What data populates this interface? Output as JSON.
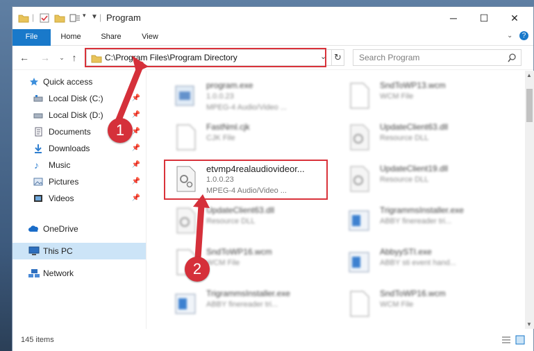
{
  "window": {
    "title": "Program"
  },
  "ribbon": {
    "tabs": [
      "File",
      "Home",
      "Share",
      "View"
    ]
  },
  "address": {
    "path": "C:\\Program Files\\Program Directory"
  },
  "search": {
    "placeholder": "Search Program"
  },
  "sidebar": {
    "items": [
      {
        "label": "Quick access",
        "icon": "star-icon"
      },
      {
        "label": "Local Disk (C:)",
        "icon": "drive-icon"
      },
      {
        "label": "Local Disk (D:)",
        "icon": "drive-icon"
      },
      {
        "label": "Documents",
        "icon": "documents-icon"
      },
      {
        "label": "Downloads",
        "icon": "download-icon"
      },
      {
        "label": "Music",
        "icon": "music-icon"
      },
      {
        "label": "Pictures",
        "icon": "pictures-icon"
      },
      {
        "label": "Videos",
        "icon": "videos-icon"
      },
      {
        "label": "OneDrive",
        "icon": "cloud-icon"
      },
      {
        "label": "This PC",
        "icon": "computer-icon"
      },
      {
        "label": "Network",
        "icon": "network-icon"
      }
    ]
  },
  "files": [
    {
      "name": "program.exe",
      "version": "1.0.0.23",
      "type": "MPEG-4 Audio/Video ..."
    },
    {
      "name": "SndToWP13.wcm",
      "version": "",
      "type": "WCM File"
    },
    {
      "name": "FastNml.cjk",
      "version": "",
      "type": "CJK File"
    },
    {
      "name": "UpdateClient63.dll",
      "version": "",
      "type": "Resource DLL"
    },
    {
      "name": "etvmp4realaudiovideor...",
      "version": "1.0.0.23",
      "type": "MPEG-4 Audio/Video ..."
    },
    {
      "name": "UpdateClient19.dll",
      "version": "",
      "type": "Resource DLL"
    },
    {
      "name": "UpdateClient63.dll",
      "version": "",
      "type": "Resource DLL"
    },
    {
      "name": "TrigrammsInstaller.exe",
      "version": "",
      "type": "ABBY finereader tri..."
    },
    {
      "name": "SndToWP16.wcm",
      "version": "",
      "type": "WCM File"
    },
    {
      "name": "AbbyySTI.exe",
      "version": "",
      "type": "ABBY sti event hand..."
    },
    {
      "name": "TrigrammsInstaller.exe",
      "version": "",
      "type": "ABBY finereader tri..."
    },
    {
      "name": "SndToWP16.wcm",
      "version": "",
      "type": "WCM File"
    }
  ],
  "status": {
    "items": "145 items"
  },
  "callouts": [
    "1",
    "2"
  ],
  "colors": {
    "accent": "#1979ca",
    "highlight": "#d9323a",
    "selected": "#cce4f7"
  }
}
